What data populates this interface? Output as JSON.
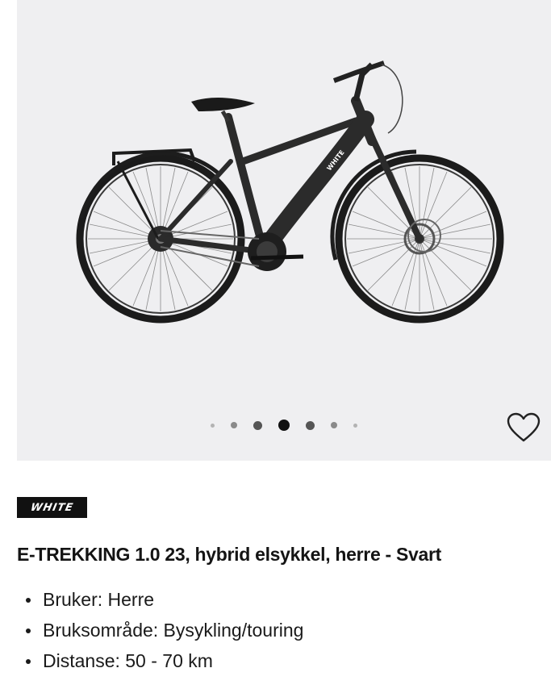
{
  "gallery": {
    "image_alt": "E-TREKKING 1.0 23 hybrid elsykkel",
    "frame_text": "WHITE",
    "dots_count": 7,
    "active_dot": 4,
    "favorite_icon": "heart-outline-icon"
  },
  "product": {
    "brand": "WHITE",
    "title": "E-TREKKING 1.0 23, hybrid elsykkel, herre - Svart",
    "features": [
      "Bruker: Herre",
      "Bruksområde: Bysykling/touring",
      "Distanse: 50 - 70 km"
    ]
  },
  "colors": {
    "gallery_bg": "#efeff1",
    "text": "#1a1a1a",
    "logo_bg": "#111111"
  }
}
